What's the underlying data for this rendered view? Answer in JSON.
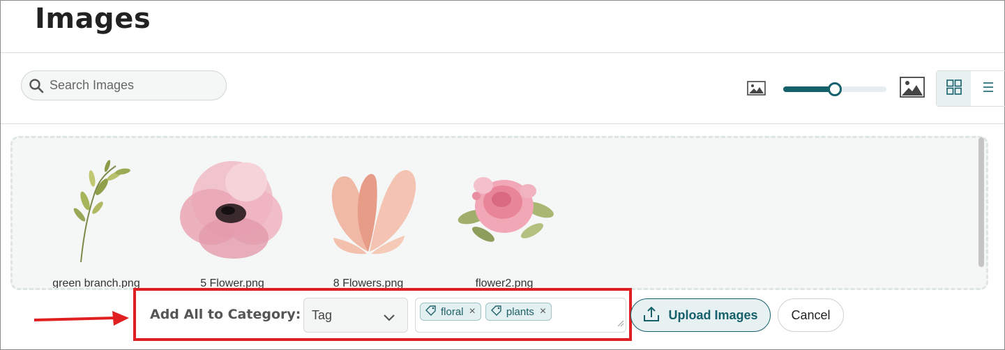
{
  "header": {
    "title": "Images"
  },
  "toolbar": {
    "search_placeholder": "Search Images",
    "size_slider_value": 0.5,
    "view_modes": [
      "grid",
      "list"
    ],
    "active_view": "grid",
    "icons": {
      "search": "search-icon",
      "small": "image-small-icon",
      "large": "image-large-icon",
      "grid": "grid-view-icon",
      "list": "list-view-icon"
    }
  },
  "images": [
    {
      "name": "green branch.png",
      "art": "green-branch"
    },
    {
      "name": "5 Flower.png",
      "art": "pink-flower"
    },
    {
      "name": "8 Flowers.png",
      "art": "peach-petals"
    },
    {
      "name": "flower2.png",
      "art": "rose-bouquet"
    }
  ],
  "category_bar": {
    "label": "Add All to Category:",
    "select_value": "Tag",
    "tags": [
      {
        "label": "floral"
      },
      {
        "label": "plants"
      }
    ]
  },
  "actions": {
    "upload_label": "Upload Images",
    "cancel_label": "Cancel"
  },
  "colors": {
    "accent": "#15606b",
    "highlight": "#e02020"
  }
}
